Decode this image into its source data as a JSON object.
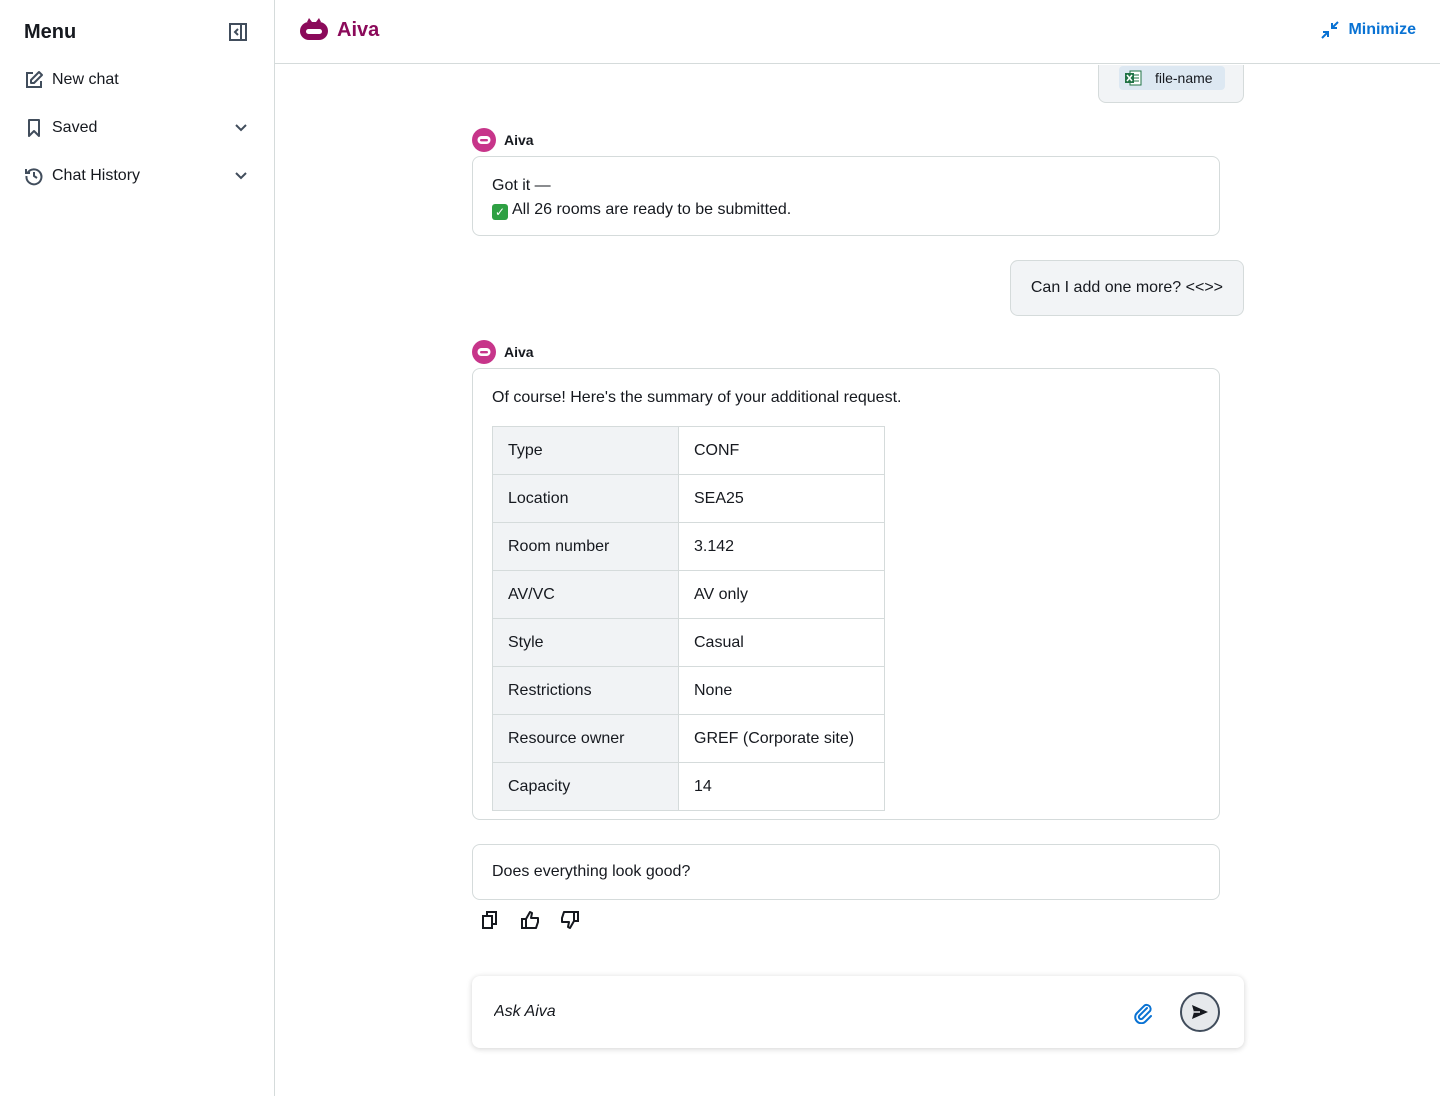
{
  "sidebar": {
    "title": "Menu",
    "items": [
      {
        "label": "New chat",
        "icon": "edit-icon"
      },
      {
        "label": "Saved",
        "icon": "bookmark-icon"
      },
      {
        "label": "Chat History",
        "icon": "history-icon"
      }
    ]
  },
  "header": {
    "brand": "Aiva",
    "minimize_label": "Minimize"
  },
  "conversation": {
    "file_name": "file-name",
    "bot_name": "Aiva",
    "msg1_line1": "Got it —",
    "msg1_line2": "All 26 rooms are ready to be submitted.",
    "user_msg": "Can I add one more? <<>>",
    "msg2_intro": "Of course! Here's the summary of your additional request.",
    "summary": [
      {
        "key": "Type",
        "value": "CONF"
      },
      {
        "key": "Location",
        "value": "SEA25"
      },
      {
        "key": "Room number",
        "value": "3.142"
      },
      {
        "key": "AV/VC",
        "value": "AV only"
      },
      {
        "key": "Style",
        "value": "Casual"
      },
      {
        "key": "Restrictions",
        "value": "None"
      },
      {
        "key": "Resource owner",
        "value": "GREF (Corporate site)"
      },
      {
        "key": "Capacity",
        "value": "14"
      }
    ],
    "msg3": "Does everything look good?"
  },
  "composer": {
    "placeholder": "Ask Aiva"
  },
  "colors": {
    "brand": "#8b0a5a",
    "avatar": "#c7358a",
    "link": "#0972d3"
  }
}
